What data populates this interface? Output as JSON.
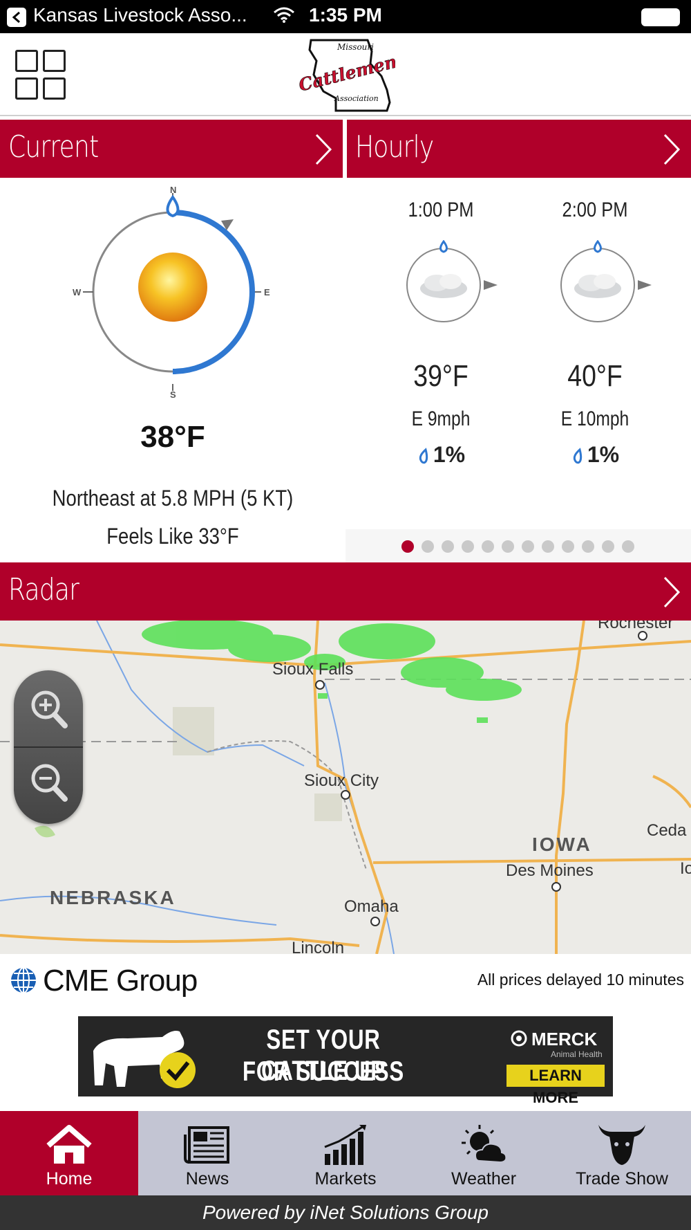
{
  "status_bar": {
    "app_name": "Kansas Livestock Asso...",
    "time": "1:35 PM"
  },
  "header": {
    "logo_text_top": "Missouri",
    "logo_text_main": "Cattlemens",
    "logo_text_bottom": "Association"
  },
  "current": {
    "title": "Current",
    "compass": {
      "n": "N",
      "s": "S",
      "e": "E",
      "w": "W"
    },
    "temperature": "38°F",
    "wind": "Northeast at 5.8 MPH (5 KT)",
    "feels_like": "Feels Like 33°F"
  },
  "hourly": {
    "title": "Hourly",
    "items": [
      {
        "time": "1:00 PM",
        "temp": "39°F",
        "wind": "E 9mph",
        "precip": "1%"
      },
      {
        "time": "2:00 PM",
        "temp": "40°F",
        "wind": "E 10mph",
        "precip": "1%"
      }
    ],
    "page_count": 12,
    "active_page": 1
  },
  "radar": {
    "title": "Radar",
    "labels": {
      "rochester": "Rochester",
      "sioux_falls": "Sioux Falls",
      "sioux_city": "Sioux City",
      "iowa": "IOWA",
      "des_moines": "Des Moines",
      "cedar": "Ceda",
      "io": "Io",
      "nebraska": "NEBRASKA",
      "omaha": "Omaha",
      "lincoln": "Lincoln"
    }
  },
  "cme": {
    "logo_text": "CME Group",
    "delay_text": "All prices delayed 10 minutes"
  },
  "ad": {
    "line1": "SET YOUR CATTLE UP",
    "line2": "FOR SUCCESS",
    "brand": "MERCK",
    "brand_sub": "Animal Health",
    "cta": "LEARN MORE"
  },
  "tabs": [
    {
      "label": "Home",
      "active": true
    },
    {
      "label": "News"
    },
    {
      "label": "Markets"
    },
    {
      "label": "Weather"
    },
    {
      "label": "Trade Show"
    }
  ],
  "footer": {
    "text": "Powered by iNet Solutions Group"
  },
  "colors": {
    "brand_red": "#b0002a",
    "tab_bg": "#c3c5d3",
    "wind_arc": "#2f78d1"
  }
}
